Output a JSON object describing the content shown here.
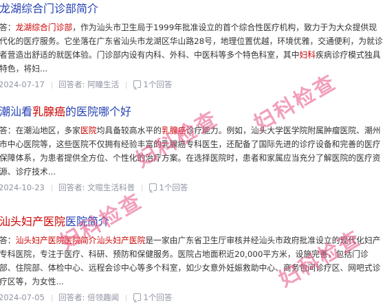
{
  "results": [
    {
      "title_pre": "",
      "title_hl": "龙湖综合门诊部简介",
      "title_post": "",
      "abstract_prefix": "答：",
      "abstract_hl": "龙湖综合门诊部",
      "abstract_text": "，作为汕头市卫生局于1999年批准设立的首个综合性医疗机构，致力于为大众提供现代化的医疗服务。它坐落在广东省汕头市龙湖区华山路28号，地理位置优越，环境优雅，交通便利，为就诊者营造出舒适的就医体验。门诊部内设有内科、外科、中医科等多个特色科室，其中",
      "abstract_hl2": "妇科",
      "abstract_text2": "疾病诊疗模式独具特色，将妇...",
      "date": "2024-07-17",
      "author": "回答者: 阿瞳生活",
      "answers": "1个回答"
    },
    {
      "title_pre": "潮汕看",
      "title_hl": "乳腺癌",
      "title_post": "的医院哪个好",
      "abstract_prefix": "答：在潮汕地区，多家",
      "abstract_hl": "医院",
      "abstract_text": "均具备较高水平的",
      "abstract_hl2": "乳腺癌",
      "abstract_text2": "诊疗能力。例如，汕头大学医学院附属肿瘤医院、潮州市中心医院等，这些医院不仅拥有经验丰富的乳腺癌专科医生，还配备了国际先进的诊疗设备和完善的医疗保障体系，为患者提供全方位、个性化的治疗方案。在选择医院时，患者和家属应当充分了解医院的医疗资源、诊疗技术...",
      "date": "2024-10-23",
      "author": "回答者: 文暄生活科普",
      "answers": "1个回答"
    },
    {
      "title_pre": "",
      "title_hl": "汕头妇产医院",
      "title_post": "医院简介",
      "abstract_prefix": "答：",
      "abstract_hl": "汕头妇产医院医院简介汕头妇产医院",
      "abstract_text": "是一家由广东省卫生厅审核并经汕头市政府批准设立的现代化妇产专科医院，专注于医疗、科研、预防和保健服务。医院占地面积近20,000平方米，设施完善，包括门诊部、住院部、体检中心、远程会诊中心等多个科室，如少女意外妊娠救助中心、商务包间诊疗区、网吧式诊疗区等，为女性...",
      "abstract_hl2": "",
      "abstract_text2": "",
      "date": "2024-07-05",
      "author": "回答者: 倍领趣闻",
      "answers": "1个回答"
    }
  ],
  "watermark": "妇科检查"
}
